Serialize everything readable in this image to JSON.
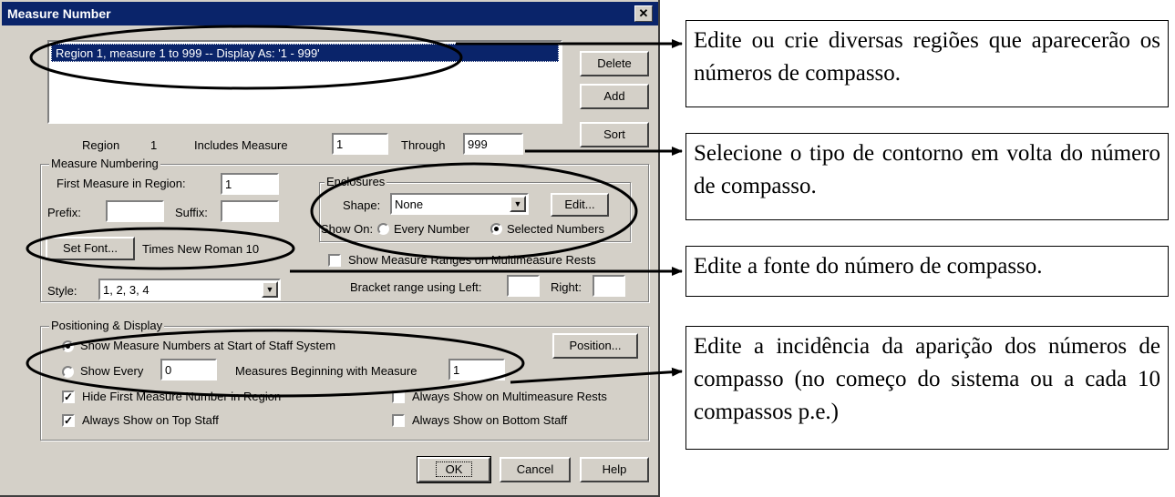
{
  "dialog": {
    "title": "Measure Number",
    "close_label": "✕",
    "region_list": [
      "Region  1, measure   1 to  999 -- Display As: '1 - 999'"
    ],
    "buttons": {
      "delete": "Delete",
      "add": "Add",
      "sort": "Sort",
      "ok": "OK",
      "cancel": "Cancel",
      "help": "Help",
      "edit": "Edit...",
      "set_font": "Set Font...",
      "position": "Position..."
    },
    "region_row": {
      "region_label": "Region",
      "region_number": "1",
      "includes_label": "Includes Measure",
      "includes_value": "1",
      "through_label": "Through",
      "through_value": "999"
    },
    "measure_numbering": {
      "legend": "Measure Numbering",
      "first_measure_label": "First Measure in Region:",
      "first_measure_value": "1",
      "prefix_label": "Prefix:",
      "prefix_value": "",
      "suffix_label": "Suffix:",
      "suffix_value": "",
      "font_display": "Times New Roman 10",
      "style_label": "Style:",
      "style_value": "1, 2, 3, 4",
      "enclosures": {
        "legend": "Enclosures",
        "shape_label": "Shape:",
        "shape_value": "None",
        "show_on_label": "Show On:",
        "every_number": "Every Number",
        "selected_numbers": "Selected Numbers",
        "selected": "selected_numbers"
      },
      "show_ranges_label": "Show Measure Ranges on Multimeasure Rests",
      "show_ranges_checked": false,
      "bracket_label": "Bracket range using  Left:",
      "bracket_left": "",
      "right_label": "Right:",
      "bracket_right": ""
    },
    "positioning": {
      "legend": "Positioning & Display",
      "show_at_start_label": "Show Measure Numbers at Start of Staff System",
      "show_every_label": "Show Every",
      "show_every_value": "0",
      "beginning_label": "Measures Beginning with Measure",
      "beginning_value": "1",
      "selected": "show_at_start",
      "checkboxes": {
        "hide_first": {
          "label": "Hide First Measure Number in Region",
          "checked": true
        },
        "always_top": {
          "label": "Always Show on Top Staff",
          "checked": true
        },
        "always_multimeasure": {
          "label": "Always Show on Multimeasure Rests",
          "checked": false
        },
        "always_bottom": {
          "label": "Always Show on Bottom Staff",
          "checked": false
        }
      },
      "check_mark": "✓"
    }
  },
  "callouts": [
    {
      "text": "Edite ou crie diversas regiões que aparecerão os números de compasso."
    },
    {
      "text": "Selecione o tipo de contorno em volta do número de compasso."
    },
    {
      "text": "Edite a fonte do número de compasso."
    },
    {
      "text": "Edite a incidência da aparição dos números de compasso (no começo do sistema ou a cada 10 compassos p.e.)"
    }
  ],
  "colors": {
    "dialog_face": "#d4d0c8",
    "titlebar": "#0a246a",
    "selection": "#0a246a",
    "annotation_ink": "#000000"
  }
}
